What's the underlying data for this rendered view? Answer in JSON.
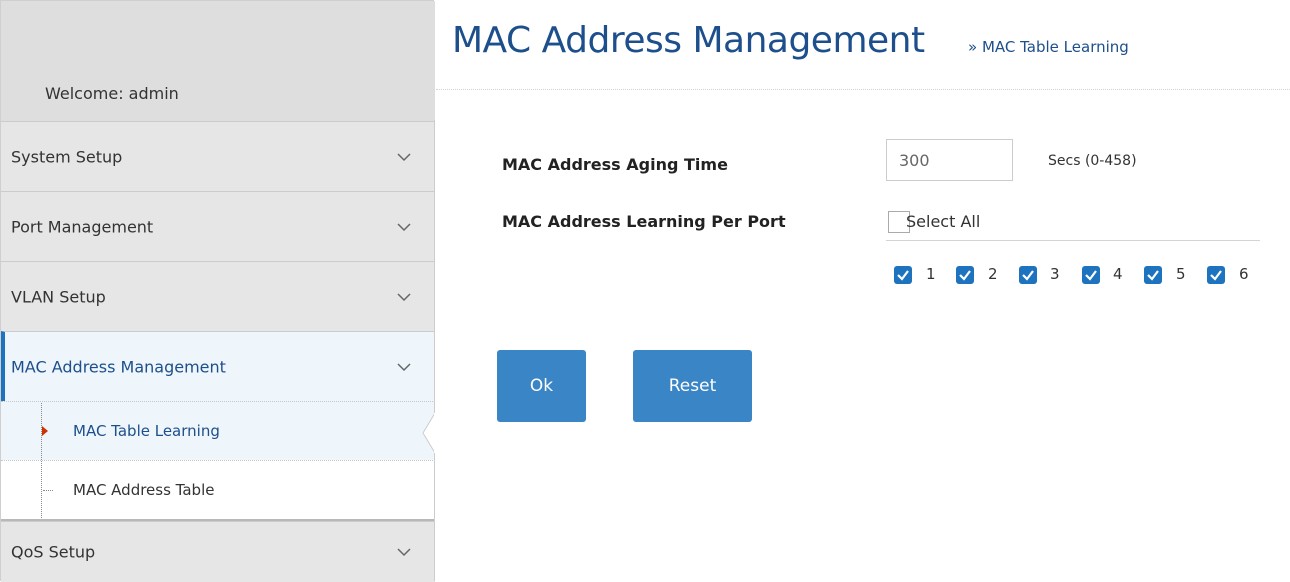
{
  "sidebar": {
    "welcome": "Welcome: admin",
    "items": [
      {
        "label": "System Setup"
      },
      {
        "label": "Port Management"
      },
      {
        "label": "VLAN Setup"
      },
      {
        "label": "MAC Address Management"
      },
      {
        "label": "QoS Setup"
      }
    ],
    "sub_items": [
      {
        "label": "MAC Table Learning"
      },
      {
        "label": "MAC Address Table"
      }
    ]
  },
  "header": {
    "title": "MAC Address Management",
    "breadcrumb": "» MAC Table Learning"
  },
  "form": {
    "aging_label": "MAC Address Aging Time",
    "aging_value": "300",
    "aging_unit": "Secs (0-458)",
    "learning_label": "MAC Address Learning Per Port",
    "select_all_label": "Select All",
    "select_all_checked": false,
    "ports": [
      {
        "label": "1",
        "checked": true
      },
      {
        "label": "2",
        "checked": true
      },
      {
        "label": "3",
        "checked": true
      },
      {
        "label": "4",
        "checked": true
      },
      {
        "label": "5",
        "checked": true
      },
      {
        "label": "6",
        "checked": true
      }
    ]
  },
  "buttons": {
    "ok": "Ok",
    "reset": "Reset"
  },
  "colors": {
    "accent": "#1e73be",
    "button": "#3a85c6",
    "title": "#1d4f8c",
    "sidebar_bg": "#e6e6e6",
    "active_bg": "#eef5fb",
    "bullet": "#cc3300"
  },
  "icons": {
    "nav_expand": "chevron-down-icon",
    "current_page": "triangle-right-icon",
    "check": "checkmark-icon"
  }
}
